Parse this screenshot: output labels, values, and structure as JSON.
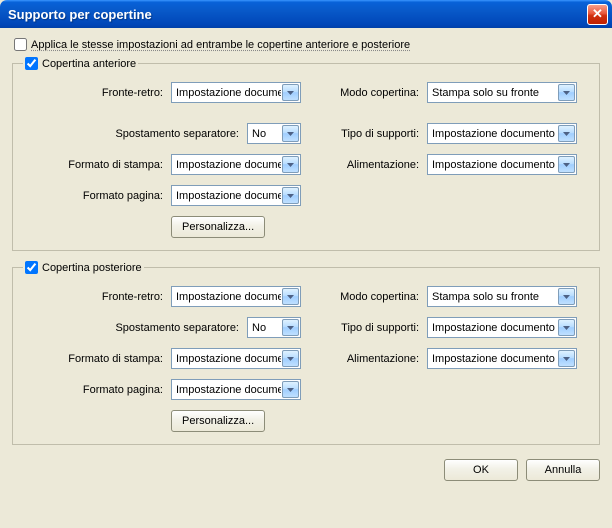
{
  "window": {
    "title": "Supporto per copertine",
    "close_label": "✕"
  },
  "apply": {
    "label": "Applica le stesse impostazioni ad entrambe le copertine anteriore e posteriore",
    "checked": false
  },
  "front": {
    "legend": "Copertina anteriore",
    "checked": true,
    "labels": {
      "duplex": "Fronte-retro:",
      "cover_mode": "Modo copertina:",
      "separator_shift": "Spostamento separatore:",
      "media_type": "Tipo di supporti:",
      "print_format": "Formato di stampa:",
      "feed": "Alimentazione:",
      "page_format": "Formato pagina:"
    },
    "values": {
      "duplex": "Impostazione documento",
      "cover_mode": "Stampa solo su fronte",
      "separator_shift": "No",
      "media_type": "Impostazione documento",
      "print_format": "Impostazione documento",
      "feed": "Impostazione documento",
      "page_format": "Impostazione documento"
    },
    "personalize": "Personalizza..."
  },
  "back": {
    "legend": "Copertina posteriore",
    "checked": true,
    "labels": {
      "duplex": "Fronte-retro:",
      "cover_mode": "Modo copertina:",
      "separator_shift": "Spostamento separatore:",
      "media_type": "Tipo di supporti:",
      "print_format": "Formato di stampa:",
      "feed": "Alimentazione:",
      "page_format": "Formato pagina:"
    },
    "values": {
      "duplex": "Impostazione documento",
      "cover_mode": "Stampa solo su fronte",
      "separator_shift": "No",
      "media_type": "Impostazione documento",
      "print_format": "Impostazione documento",
      "feed": "Impostazione documento",
      "page_format": "Impostazione documento"
    },
    "personalize": "Personalizza..."
  },
  "footer": {
    "ok": "OK",
    "cancel": "Annulla"
  }
}
